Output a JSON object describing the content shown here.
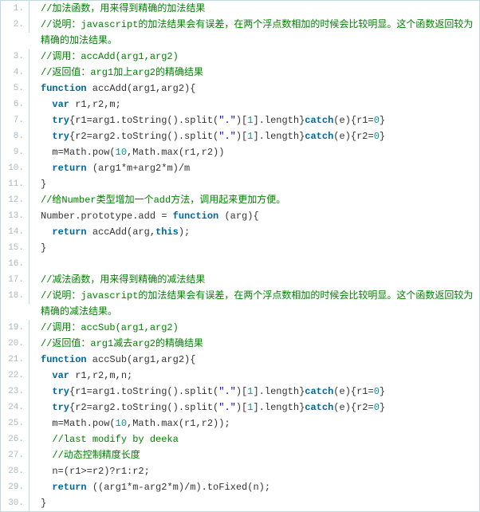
{
  "lines": [
    {
      "num": "1.",
      "tokens": [
        [
          "//加法函数，用来得到精确的加法结果",
          "cmt"
        ]
      ]
    },
    {
      "num": "2.",
      "tokens": [
        [
          "//说明：javascript的加法结果会有误差，在两个浮点数相加的时候会比较明显。这个函数返回较为精确的加法结果。",
          "cmt"
        ]
      ]
    },
    {
      "num": "3.",
      "tokens": [
        [
          "//调用：accAdd(arg1,arg2)",
          "cmt"
        ]
      ]
    },
    {
      "num": "4.",
      "tokens": [
        [
          "//返回值：arg1加上arg2的精确结果",
          "cmt"
        ]
      ]
    },
    {
      "num": "5.",
      "tokens": [
        [
          "function",
          "kw"
        ],
        [
          " accAdd(arg1,arg2){",
          ""
        ]
      ]
    },
    {
      "num": "6.",
      "tokens": [
        [
          "  ",
          ""
        ],
        [
          "var",
          "kw"
        ],
        [
          " r1,r2,m;",
          ""
        ]
      ]
    },
    {
      "num": "7.",
      "tokens": [
        [
          "  ",
          ""
        ],
        [
          "try",
          "kw"
        ],
        [
          "{r1=arg1.toString().split(",
          ""
        ],
        [
          "\".\"",
          "str"
        ],
        [
          ")[",
          ""
        ],
        [
          "1",
          "num"
        ],
        [
          "].length}",
          ""
        ],
        [
          "catch",
          "kw"
        ],
        [
          "(e){r1=",
          ""
        ],
        [
          "0",
          "num"
        ],
        [
          "}",
          ""
        ]
      ]
    },
    {
      "num": "8.",
      "tokens": [
        [
          "  ",
          ""
        ],
        [
          "try",
          "kw"
        ],
        [
          "{r2=arg2.toString().split(",
          ""
        ],
        [
          "\".\"",
          "str"
        ],
        [
          ")[",
          ""
        ],
        [
          "1",
          "num"
        ],
        [
          "].length}",
          ""
        ],
        [
          "catch",
          "kw"
        ],
        [
          "(e){r2=",
          ""
        ],
        [
          "0",
          "num"
        ],
        [
          "}",
          ""
        ]
      ]
    },
    {
      "num": "9.",
      "tokens": [
        [
          "  m=Math.pow(",
          ""
        ],
        [
          "10",
          "num"
        ],
        [
          ",Math.max(r1,r2))",
          ""
        ]
      ]
    },
    {
      "num": "10.",
      "tokens": [
        [
          "  ",
          ""
        ],
        [
          "return",
          "kw"
        ],
        [
          " (arg1*m+arg2*m)/m",
          ""
        ]
      ]
    },
    {
      "num": "11.",
      "tokens": [
        [
          "}",
          ""
        ]
      ]
    },
    {
      "num": "12.",
      "tokens": [
        [
          "//给Number类型增加一个add方法，调用起来更加方便。",
          "cmt"
        ]
      ]
    },
    {
      "num": "13.",
      "tokens": [
        [
          "Number.prototype.add = ",
          ""
        ],
        [
          "function",
          "kw"
        ],
        [
          " (arg){",
          ""
        ]
      ]
    },
    {
      "num": "14.",
      "tokens": [
        [
          "  ",
          ""
        ],
        [
          "return",
          "kw"
        ],
        [
          " accAdd(arg,",
          ""
        ],
        [
          "this",
          "kw"
        ],
        [
          ");",
          ""
        ]
      ]
    },
    {
      "num": "15.",
      "tokens": [
        [
          "}",
          ""
        ]
      ]
    },
    {
      "num": "16.",
      "tokens": [
        [
          " ",
          ""
        ]
      ]
    },
    {
      "num": "17.",
      "tokens": [
        [
          "//减法函数，用来得到精确的减法结果",
          "cmt"
        ]
      ]
    },
    {
      "num": "18.",
      "tokens": [
        [
          "//说明：javascript的加法结果会有误差，在两个浮点数相加的时候会比较明显。这个函数返回较为精确的减法结果。",
          "cmt"
        ]
      ]
    },
    {
      "num": "19.",
      "tokens": [
        [
          "//调用：accSub(arg1,arg2)",
          "cmt"
        ]
      ]
    },
    {
      "num": "20.",
      "tokens": [
        [
          "//返回值：arg1减去arg2的精确结果",
          "cmt"
        ]
      ]
    },
    {
      "num": "21.",
      "tokens": [
        [
          "function",
          "kw"
        ],
        [
          " accSub(arg1,arg2){",
          ""
        ]
      ]
    },
    {
      "num": "22.",
      "tokens": [
        [
          "  ",
          ""
        ],
        [
          "var",
          "kw"
        ],
        [
          " r1,r2,m,n;",
          ""
        ]
      ]
    },
    {
      "num": "23.",
      "tokens": [
        [
          "  ",
          ""
        ],
        [
          "try",
          "kw"
        ],
        [
          "{r1=arg1.toString().split(",
          ""
        ],
        [
          "\".\"",
          "str"
        ],
        [
          ")[",
          ""
        ],
        [
          "1",
          "num"
        ],
        [
          "].length}",
          ""
        ],
        [
          "catch",
          "kw"
        ],
        [
          "(e){r1=",
          ""
        ],
        [
          "0",
          "num"
        ],
        [
          "}",
          ""
        ]
      ]
    },
    {
      "num": "24.",
      "tokens": [
        [
          "  ",
          ""
        ],
        [
          "try",
          "kw"
        ],
        [
          "{r2=arg2.toString().split(",
          ""
        ],
        [
          "\".\"",
          "str"
        ],
        [
          ")[",
          ""
        ],
        [
          "1",
          "num"
        ],
        [
          "].length}",
          ""
        ],
        [
          "catch",
          "kw"
        ],
        [
          "(e){r2=",
          ""
        ],
        [
          "0",
          "num"
        ],
        [
          "}",
          ""
        ]
      ]
    },
    {
      "num": "25.",
      "tokens": [
        [
          "  m=Math.pow(",
          ""
        ],
        [
          "10",
          "num"
        ],
        [
          ",Math.max(r1,r2));",
          ""
        ]
      ]
    },
    {
      "num": "26.",
      "tokens": [
        [
          "  ",
          ""
        ],
        [
          "//last modify by deeka",
          "cmt"
        ]
      ]
    },
    {
      "num": "27.",
      "tokens": [
        [
          "  ",
          ""
        ],
        [
          "//动态控制精度长度",
          "cmt"
        ]
      ]
    },
    {
      "num": "28.",
      "tokens": [
        [
          "  n=(r1>=r2)?r1:r2;",
          ""
        ]
      ]
    },
    {
      "num": "29.",
      "tokens": [
        [
          "  ",
          ""
        ],
        [
          "return",
          "kw"
        ],
        [
          " ((arg1*m-arg2*m)/m).toFixed(n);",
          ""
        ]
      ]
    },
    {
      "num": "30.",
      "tokens": [
        [
          "}",
          ""
        ]
      ]
    }
  ]
}
